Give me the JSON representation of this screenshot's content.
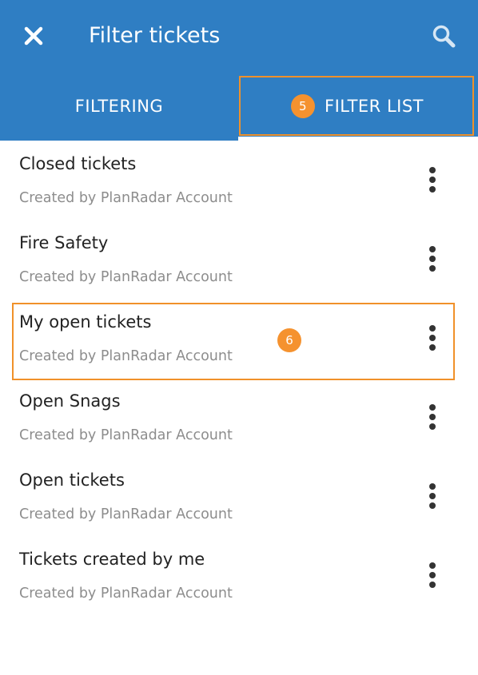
{
  "header": {
    "title": "Filter tickets",
    "close_icon": "close-icon",
    "search_icon": "search-icon",
    "background_color": "#2f7ec3"
  },
  "tabs": [
    {
      "label": "FILTERING",
      "active": false
    },
    {
      "label": "FILTER LIST",
      "active": true,
      "badge": "5"
    }
  ],
  "list": {
    "items": [
      {
        "title": "Closed tickets",
        "subtitle": "Created by PlanRadar Account"
      },
      {
        "title": "Fire Safety",
        "subtitle": "Created by PlanRadar Account"
      },
      {
        "title": "My open tickets",
        "subtitle": "Created by PlanRadar Account",
        "badge": "6",
        "highlighted": true
      },
      {
        "title": "Open Snags",
        "subtitle": "Created by PlanRadar Account"
      },
      {
        "title": "Open tickets",
        "subtitle": "Created by PlanRadar Account"
      },
      {
        "title": "Tickets created by me",
        "subtitle": "Created by PlanRadar Account"
      }
    ],
    "item_menu_icon": "more-vertical-icon"
  },
  "colors": {
    "accent": "#2f7ec3",
    "callout": "#f5922f",
    "text_primary": "#222222",
    "text_secondary": "#8d8d8d"
  }
}
